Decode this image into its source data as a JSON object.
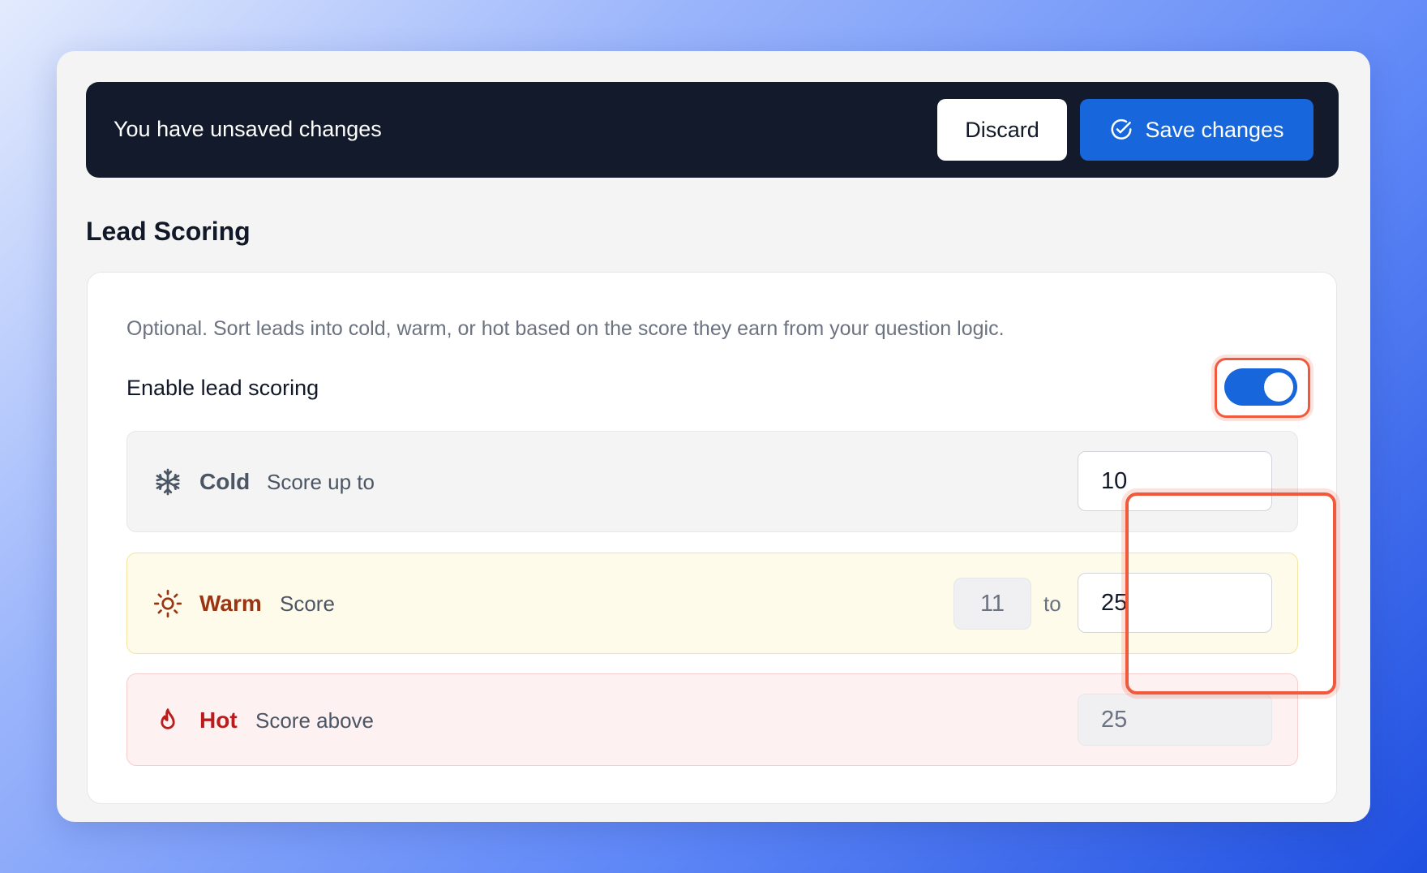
{
  "banner": {
    "message": "You have unsaved changes",
    "discard_label": "Discard",
    "save_label": "Save changes"
  },
  "section": {
    "title": "Lead Scoring",
    "description": "Optional. Sort leads into cold, warm, or hot based on the score they earn from your question logic.",
    "toggle_label": "Enable lead scoring",
    "toggle_on": true
  },
  "tiers": {
    "cold": {
      "name": "Cold",
      "desc": "Score up to",
      "value": "10",
      "icon": "snowflake-icon"
    },
    "warm": {
      "name": "Warm",
      "desc": "Score",
      "min": "11",
      "to": "to",
      "max": "25",
      "icon": "sun-icon"
    },
    "hot": {
      "name": "Hot",
      "desc": "Score above",
      "value": "25",
      "icon": "flame-icon"
    }
  },
  "colors": {
    "primary": "#1766dc",
    "banner_bg": "#121a2b",
    "highlight": "#f05a3c",
    "warm_text": "#9a3412",
    "hot_text": "#b91c1c"
  }
}
